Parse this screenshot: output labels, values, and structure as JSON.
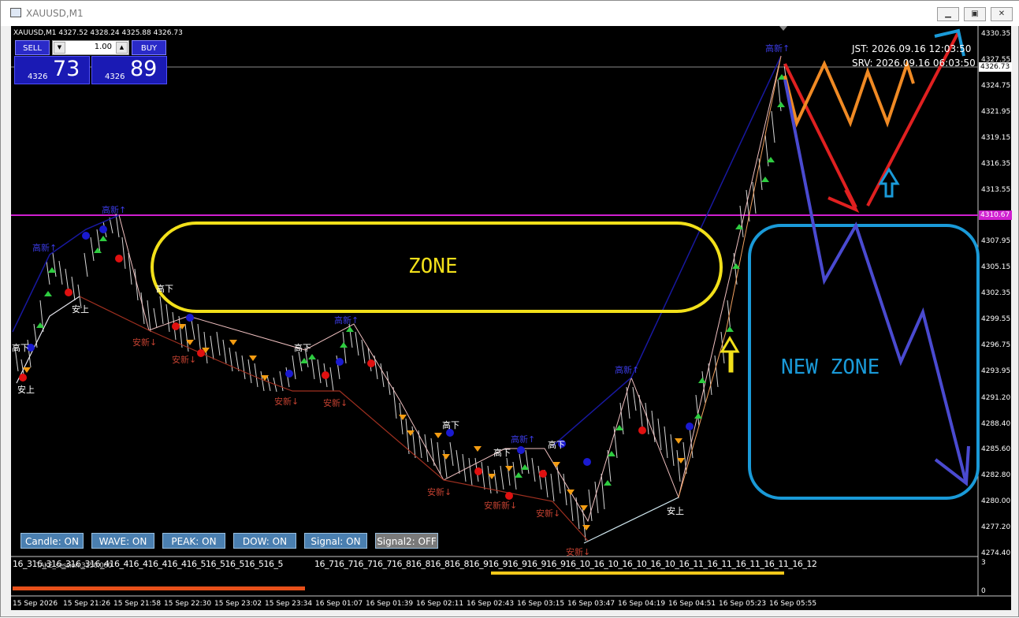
{
  "window": {
    "title": "XAUUSD,M1",
    "min_icon": "minimize-icon",
    "restore_icon": "restore-icon",
    "close_icon": "close-icon"
  },
  "chart": {
    "symbol_header": "XAUUSD,M1  4327.52 4328.24 4325.88 4326.73",
    "trade": {
      "sell_label": "SELL",
      "buy_label": "BUY",
      "volume": "1.00",
      "sell_small": "4326",
      "sell_big": "73",
      "buy_small": "4326",
      "buy_big": "89"
    },
    "clock": {
      "jst": "JST: 2026.09.16 12:03:50",
      "srv": "SRV: 2026.09.16 06:03:50"
    },
    "price_axis": [
      "4330.35",
      "4327.55",
      "4324.75",
      "4321.95",
      "4319.15",
      "4316.35",
      "4313.55",
      "4310.75",
      "4307.95",
      "4305.15",
      "4302.35",
      "4299.55",
      "4296.75",
      "4293.95",
      "4291.20",
      "4288.40",
      "4285.60",
      "4282.80",
      "4280.00",
      "4277.20",
      "4274.40"
    ],
    "current_price": "4326.73",
    "level_price": "4310.67",
    "sub_axis": [
      "3",
      "0"
    ],
    "time_axis": [
      "15 Sep 2026",
      "15 Sep 21:26",
      "15 Sep 21:58",
      "15 Sep 22:30",
      "15 Sep 23:02",
      "15 Sep 23:34",
      "16 Sep 01:07",
      "16 Sep 01:39",
      "16 Sep 02:11",
      "16 Sep 02:43",
      "16 Sep 03:15",
      "16 Sep 03:47",
      "16 Sep 04:19",
      "16 Sep 04:51",
      "16 Sep 05:23",
      "16 Sep 05:55"
    ],
    "sub_labels_left": "16_316_316_316_316_416_416_416_416_416_516_516_516_516_5",
    "sub_labels_overlay": "TAKE_session:3150.000",
    "sub_labels_right": "16_716_716_716_716_816_816_816_816_916_916_916_916_916_10_16_10_16_10_16_10_16_11_16_11_16_11_16_11_16_12",
    "toggles": [
      {
        "label": "Candle: ON",
        "state": "on"
      },
      {
        "label": "WAVE: ON",
        "state": "on"
      },
      {
        "label": "PEAK: ON",
        "state": "on"
      },
      {
        "label": "DOW: ON",
        "state": "on"
      },
      {
        "label": "Signal: ON",
        "state": "on"
      },
      {
        "label": "Signal2: OFF",
        "state": "off"
      }
    ],
    "zones": {
      "zone": "ZONE",
      "new_zone": "NEW ZONE"
    },
    "annotations": {
      "high_new": "高新↑",
      "low_new": "安新↓",
      "high_down": "高下",
      "low_up": "安上",
      "low_new_combo": "安新新↓"
    },
    "colors": {
      "background": "#000000",
      "level_line": "#d020d0",
      "zone_yellow": "#f2e01a",
      "zone_blue": "#1a9ad8",
      "arrow_red": "#e02020",
      "arrow_orange": "#f08a24",
      "arrow_purple": "#4a4ad0"
    }
  }
}
